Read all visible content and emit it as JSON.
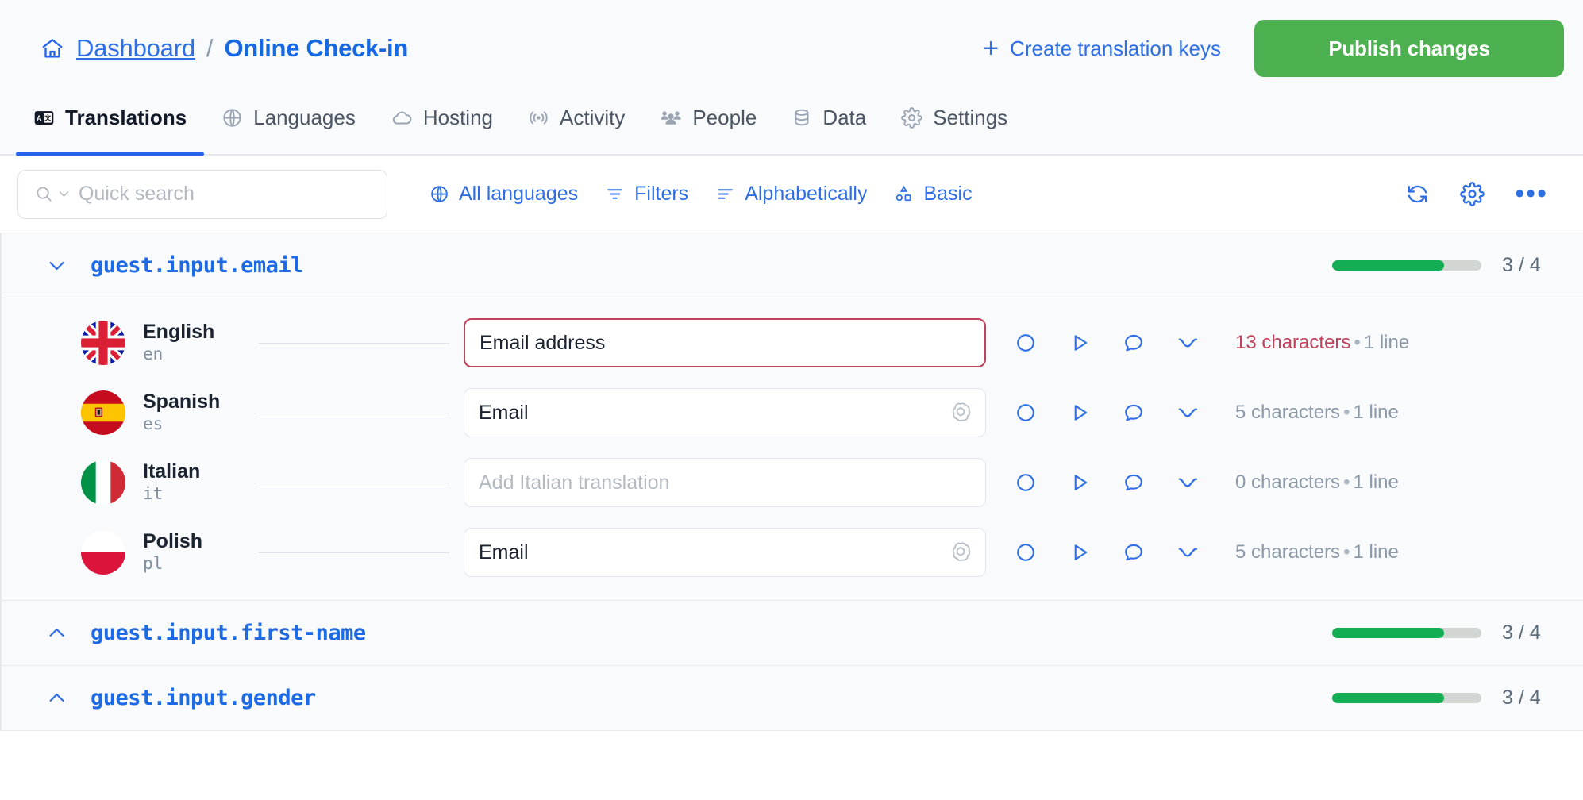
{
  "breadcrumb": {
    "home_icon": "home-icon",
    "root": "Dashboard",
    "separator": "/",
    "current": "Online Check-in"
  },
  "header_actions": {
    "create_keys_label": "Create translation keys",
    "create_keys_icon": "plus-icon",
    "publish_label": "Publish changes",
    "publish_color": "#4caf50"
  },
  "tabs": [
    {
      "label": "Translations",
      "icon": "translate-icon",
      "active": true
    },
    {
      "label": "Languages",
      "icon": "globe-icon",
      "active": false
    },
    {
      "label": "Hosting",
      "icon": "cloud-icon",
      "active": false
    },
    {
      "label": "Activity",
      "icon": "broadcast-icon",
      "active": false
    },
    {
      "label": "People",
      "icon": "people-icon",
      "active": false
    },
    {
      "label": "Data",
      "icon": "database-icon",
      "active": false
    },
    {
      "label": "Settings",
      "icon": "gear-icon",
      "active": false
    }
  ],
  "toolbar": {
    "search_placeholder": "Quick search",
    "search_value": "",
    "search_icon": "search-icon",
    "search_chevron": "chevron-down-icon",
    "items": [
      {
        "label": "All languages",
        "icon": "globe-icon"
      },
      {
        "label": "Filters",
        "icon": "filter-icon"
      },
      {
        "label": "Alphabetically",
        "icon": "sort-icon"
      },
      {
        "label": "Basic",
        "icon": "shapes-icon"
      }
    ],
    "right_icons": [
      {
        "name": "refresh-icon"
      },
      {
        "name": "gear-icon"
      },
      {
        "name": "more-icon",
        "glyph": "•••"
      }
    ],
    "accent_color": "#2f6fe4"
  },
  "key_groups": [
    {
      "name": "guest.input.email",
      "expanded": true,
      "chevron": "chevron-down-icon",
      "progress_done": 3,
      "progress_total": 4,
      "progress_label": "3 / 4",
      "progress_percent": 75,
      "translations": [
        {
          "language": "English",
          "code": "en",
          "flag": "flag-gb",
          "value": "Email address",
          "placeholder": "",
          "invalid": true,
          "ai_suggestion": false,
          "characters": "13 characters",
          "lines": "1 line",
          "separator": "•",
          "count_warn": true
        },
        {
          "language": "Spanish",
          "code": "es",
          "flag": "flag-es",
          "value": "Email",
          "placeholder": "",
          "invalid": false,
          "ai_suggestion": true,
          "characters": "5 characters",
          "lines": "1 line",
          "separator": "•",
          "count_warn": false
        },
        {
          "language": "Italian",
          "code": "it",
          "flag": "flag-it",
          "value": "",
          "placeholder": "Add Italian translation",
          "invalid": false,
          "ai_suggestion": false,
          "characters": "0 characters",
          "lines": "1 line",
          "separator": "•",
          "count_warn": false
        },
        {
          "language": "Polish",
          "code": "pl",
          "flag": "flag-pl",
          "value": "Email",
          "placeholder": "",
          "invalid": false,
          "ai_suggestion": true,
          "characters": "5 characters",
          "lines": "1 line",
          "separator": "•",
          "count_warn": false
        }
      ],
      "row_action_icons": [
        "circle-icon",
        "play-icon",
        "comment-icon",
        "tag-icon"
      ]
    },
    {
      "name": "guest.input.first-name",
      "expanded": false,
      "chevron": "chevron-up-icon",
      "progress_done": 3,
      "progress_total": 4,
      "progress_label": "3 / 4",
      "progress_percent": 75,
      "translations": []
    },
    {
      "name": "guest.input.gender",
      "expanded": false,
      "chevron": "chevron-up-icon",
      "progress_done": 3,
      "progress_total": 4,
      "progress_label": "3 / 4",
      "progress_percent": 75,
      "translations": []
    }
  ]
}
